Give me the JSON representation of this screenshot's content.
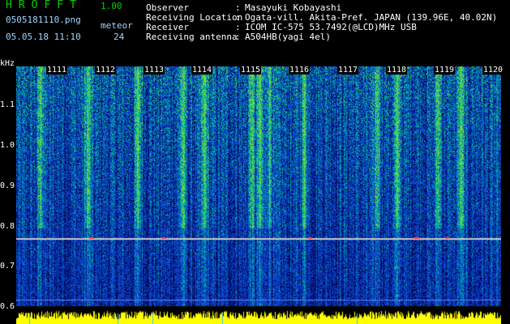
{
  "header": {
    "app_title": "HROFFT",
    "app_version": "1.00",
    "file_name": "0505181110.png",
    "meteor_label": "meteor",
    "timestamp": "05.05.18 11:10",
    "meteor_count": "24"
  },
  "info": [
    {
      "label": "Observer",
      "value": "Masayuki Kobayashi"
    },
    {
      "label": "Receiving Location",
      "value": "Ogata-vill. Akita-Pref. JAPAN (139.96E, 40.02N)"
    },
    {
      "label": "Receiver",
      "value": "ICOM IC-575 53.7492(@LCD)MHz USB"
    },
    {
      "label": "Receiving antenna",
      "value": "A504HB(yagi 4el)"
    }
  ],
  "separator": ":",
  "plot": {
    "y_unit": "kHz",
    "y_ticks": [
      "1.1",
      "1.0",
      "0.9",
      "0.8",
      "0.7",
      "0.6"
    ],
    "y_range": [
      0.59,
      1.19
    ],
    "x_ticks": [
      "1111",
      "1112",
      "1113",
      "1114",
      "1115",
      "1116",
      "1117",
      "1118",
      "1119",
      "1120"
    ],
    "colors": {
      "background": "#000000",
      "noise": "#1a3cc8",
      "signal": "#00c878",
      "strong": "#e0e000",
      "hot": "#ff3030",
      "level_bar": "#ffff00"
    }
  }
}
